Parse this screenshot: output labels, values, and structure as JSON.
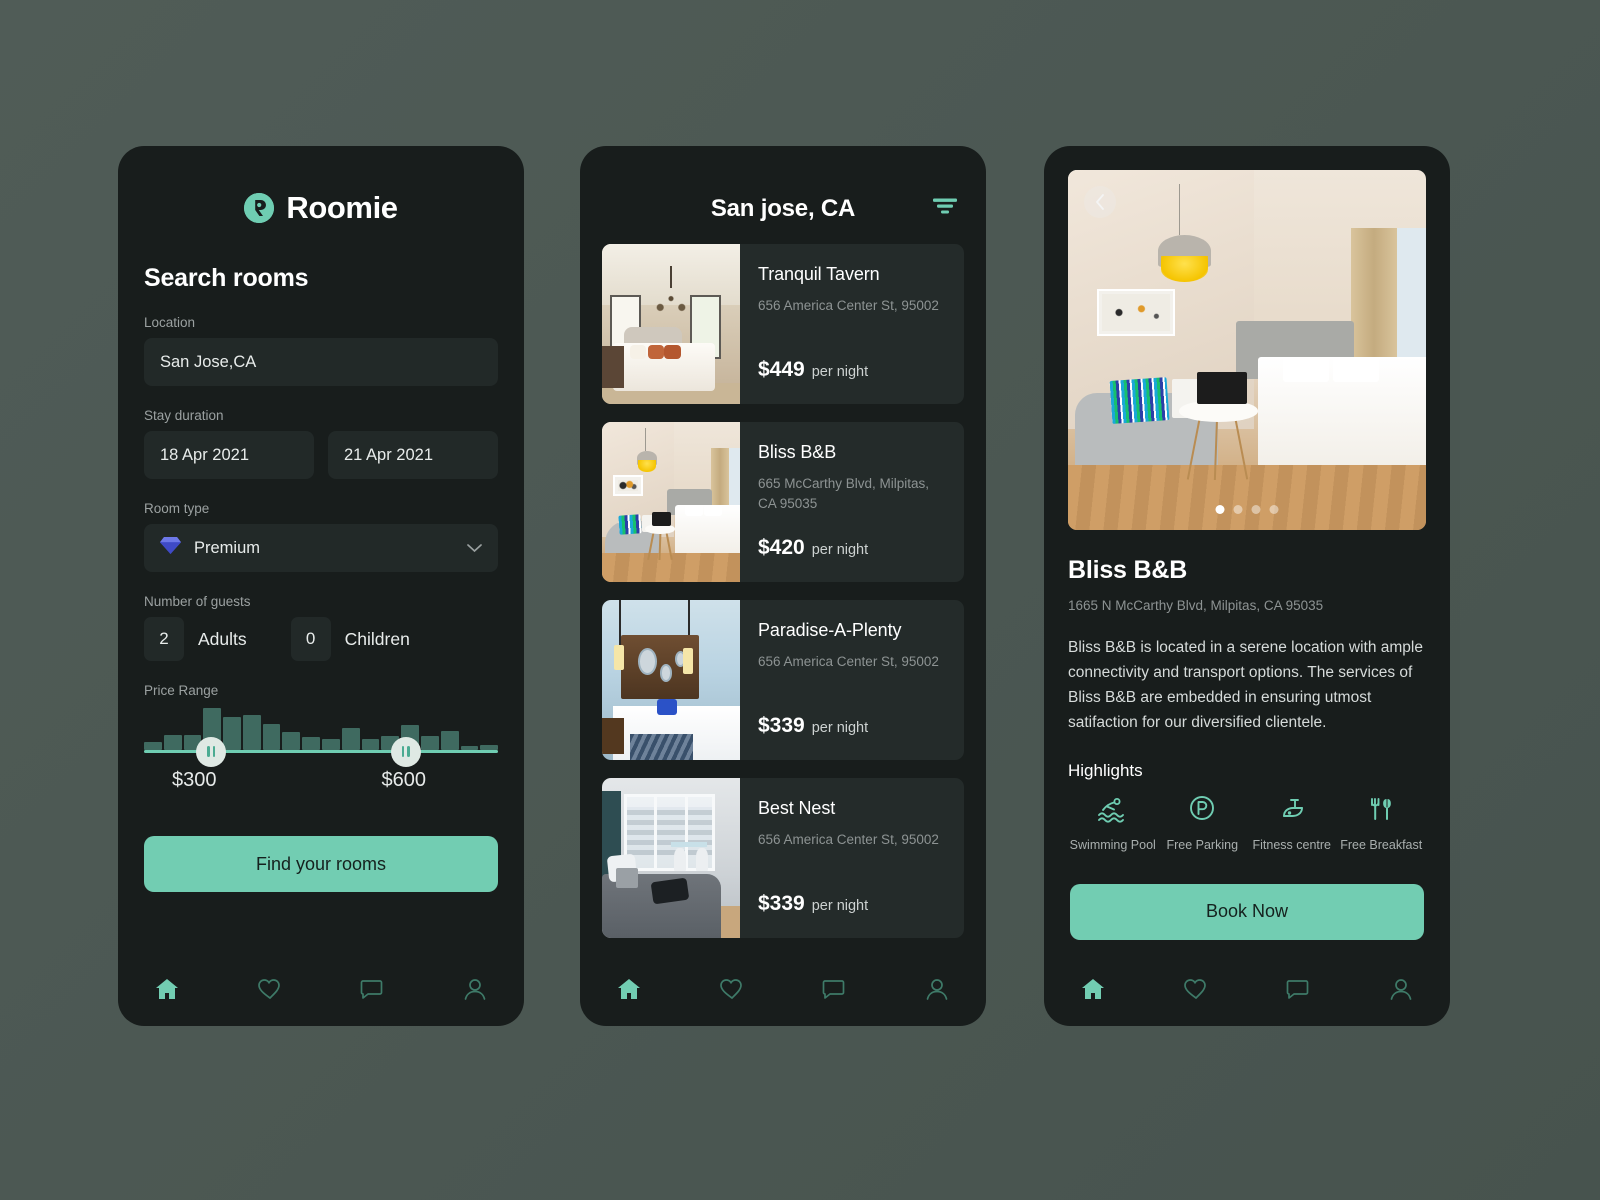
{
  "brand": {
    "name": "Roomie",
    "accent": "#72cdb2"
  },
  "search_panel": {
    "title": "Search rooms",
    "location": {
      "label": "Location",
      "value": "San Jose,CA"
    },
    "stay": {
      "label": "Stay duration",
      "checkin": "18 Apr 2021",
      "checkout": "21 Apr 2021"
    },
    "room_type": {
      "label": "Room type",
      "value": "Premium",
      "icon": "diamond-icon"
    },
    "guests": {
      "label": "Number of guests",
      "adults_count": "2",
      "adults_label": "Adults",
      "children_count": "0",
      "children_label": "Children"
    },
    "price_range": {
      "label": "Price Range",
      "min_label": "$300",
      "max_label": "$600",
      "min_pct": 19,
      "max_pct": 74,
      "histogram": [
        18,
        34,
        34,
        96,
        74,
        80,
        58,
        40,
        30,
        24,
        50,
        24,
        32,
        56,
        32,
        44,
        10,
        12
      ]
    },
    "cta": "Find your rooms"
  },
  "results_panel": {
    "title": "San jose, CA",
    "filter_icon": "filter-icon",
    "per_night": "per night",
    "listings": [
      {
        "name": "Tranquil Tavern",
        "address": "656 America Center St, 95002",
        "price": "$449",
        "thumb": "t1"
      },
      {
        "name": "Bliss B&B",
        "address": "665 McCarthy Blvd, Milpitas, CA 95035",
        "price": "$420",
        "thumb": "t2"
      },
      {
        "name": "Paradise-A-Plenty",
        "address": "656 America Center St, 95002",
        "price": "$339",
        "thumb": "t3"
      },
      {
        "name": "Best Nest",
        "address": "656 America Center St, 95002",
        "price": "$339",
        "thumb": "t4"
      }
    ]
  },
  "detail_panel": {
    "back_icon": "chevron-left-icon",
    "carousel": {
      "count": 4,
      "active": 0
    },
    "title": "Bliss B&B",
    "address": "1665 N McCarthy Blvd, Milpitas, CA 95035",
    "description": "Bliss B&B is located in a serene  location with ample connectivity and transport options. The services of Bliss B&B are embedded in ensuring utmost satifaction for our diversified clientele.",
    "highlights_title": "Highlights",
    "highlights": [
      {
        "label": "Swimming Pool",
        "icon": "swimming-pool-icon"
      },
      {
        "label": "Free Parking",
        "icon": "parking-icon"
      },
      {
        "label": "Fitness centre",
        "icon": "exercise-bike-icon"
      },
      {
        "label": "Free Breakfast",
        "icon": "cutlery-icon"
      }
    ],
    "cta": "Book Now"
  },
  "bottom_nav": [
    {
      "name": "home",
      "icon": "home-icon",
      "active": true
    },
    {
      "name": "favorites",
      "icon": "heart-icon",
      "active": false
    },
    {
      "name": "messages",
      "icon": "chat-icon",
      "active": false
    },
    {
      "name": "profile",
      "icon": "user-icon",
      "active": false
    }
  ]
}
